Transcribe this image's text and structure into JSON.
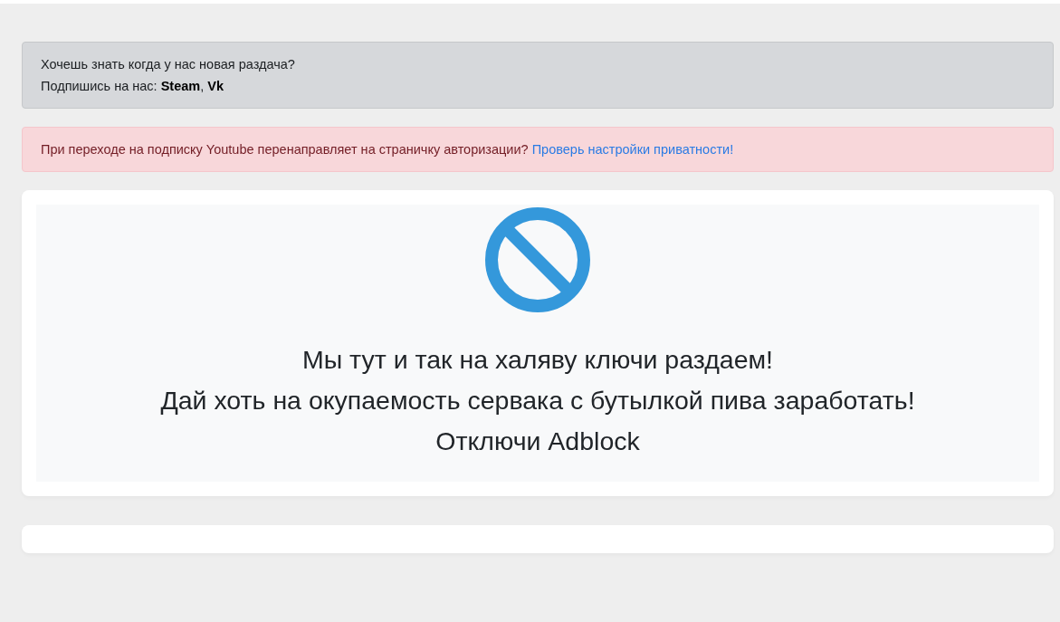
{
  "subscribe_alert": {
    "lines": [
      "Хочешь знать когда у нас новая раздача?",
      "Подпишись на нас: **Steam**, **Vk**"
    ]
  },
  "privacy_alert": {
    "text": "При переходе на подписку Youtube перенаправляет на страничку авторизации?",
    "link": "Проверь настройки приватности!"
  },
  "adblock_notice": {
    "lines": [
      "Мы тут и так на халяву ключи раздаем!",
      "Дай хоть на окупаемость сервака с бутылкой пива заработать!",
      "Отключи Adblock"
    ]
  }
}
